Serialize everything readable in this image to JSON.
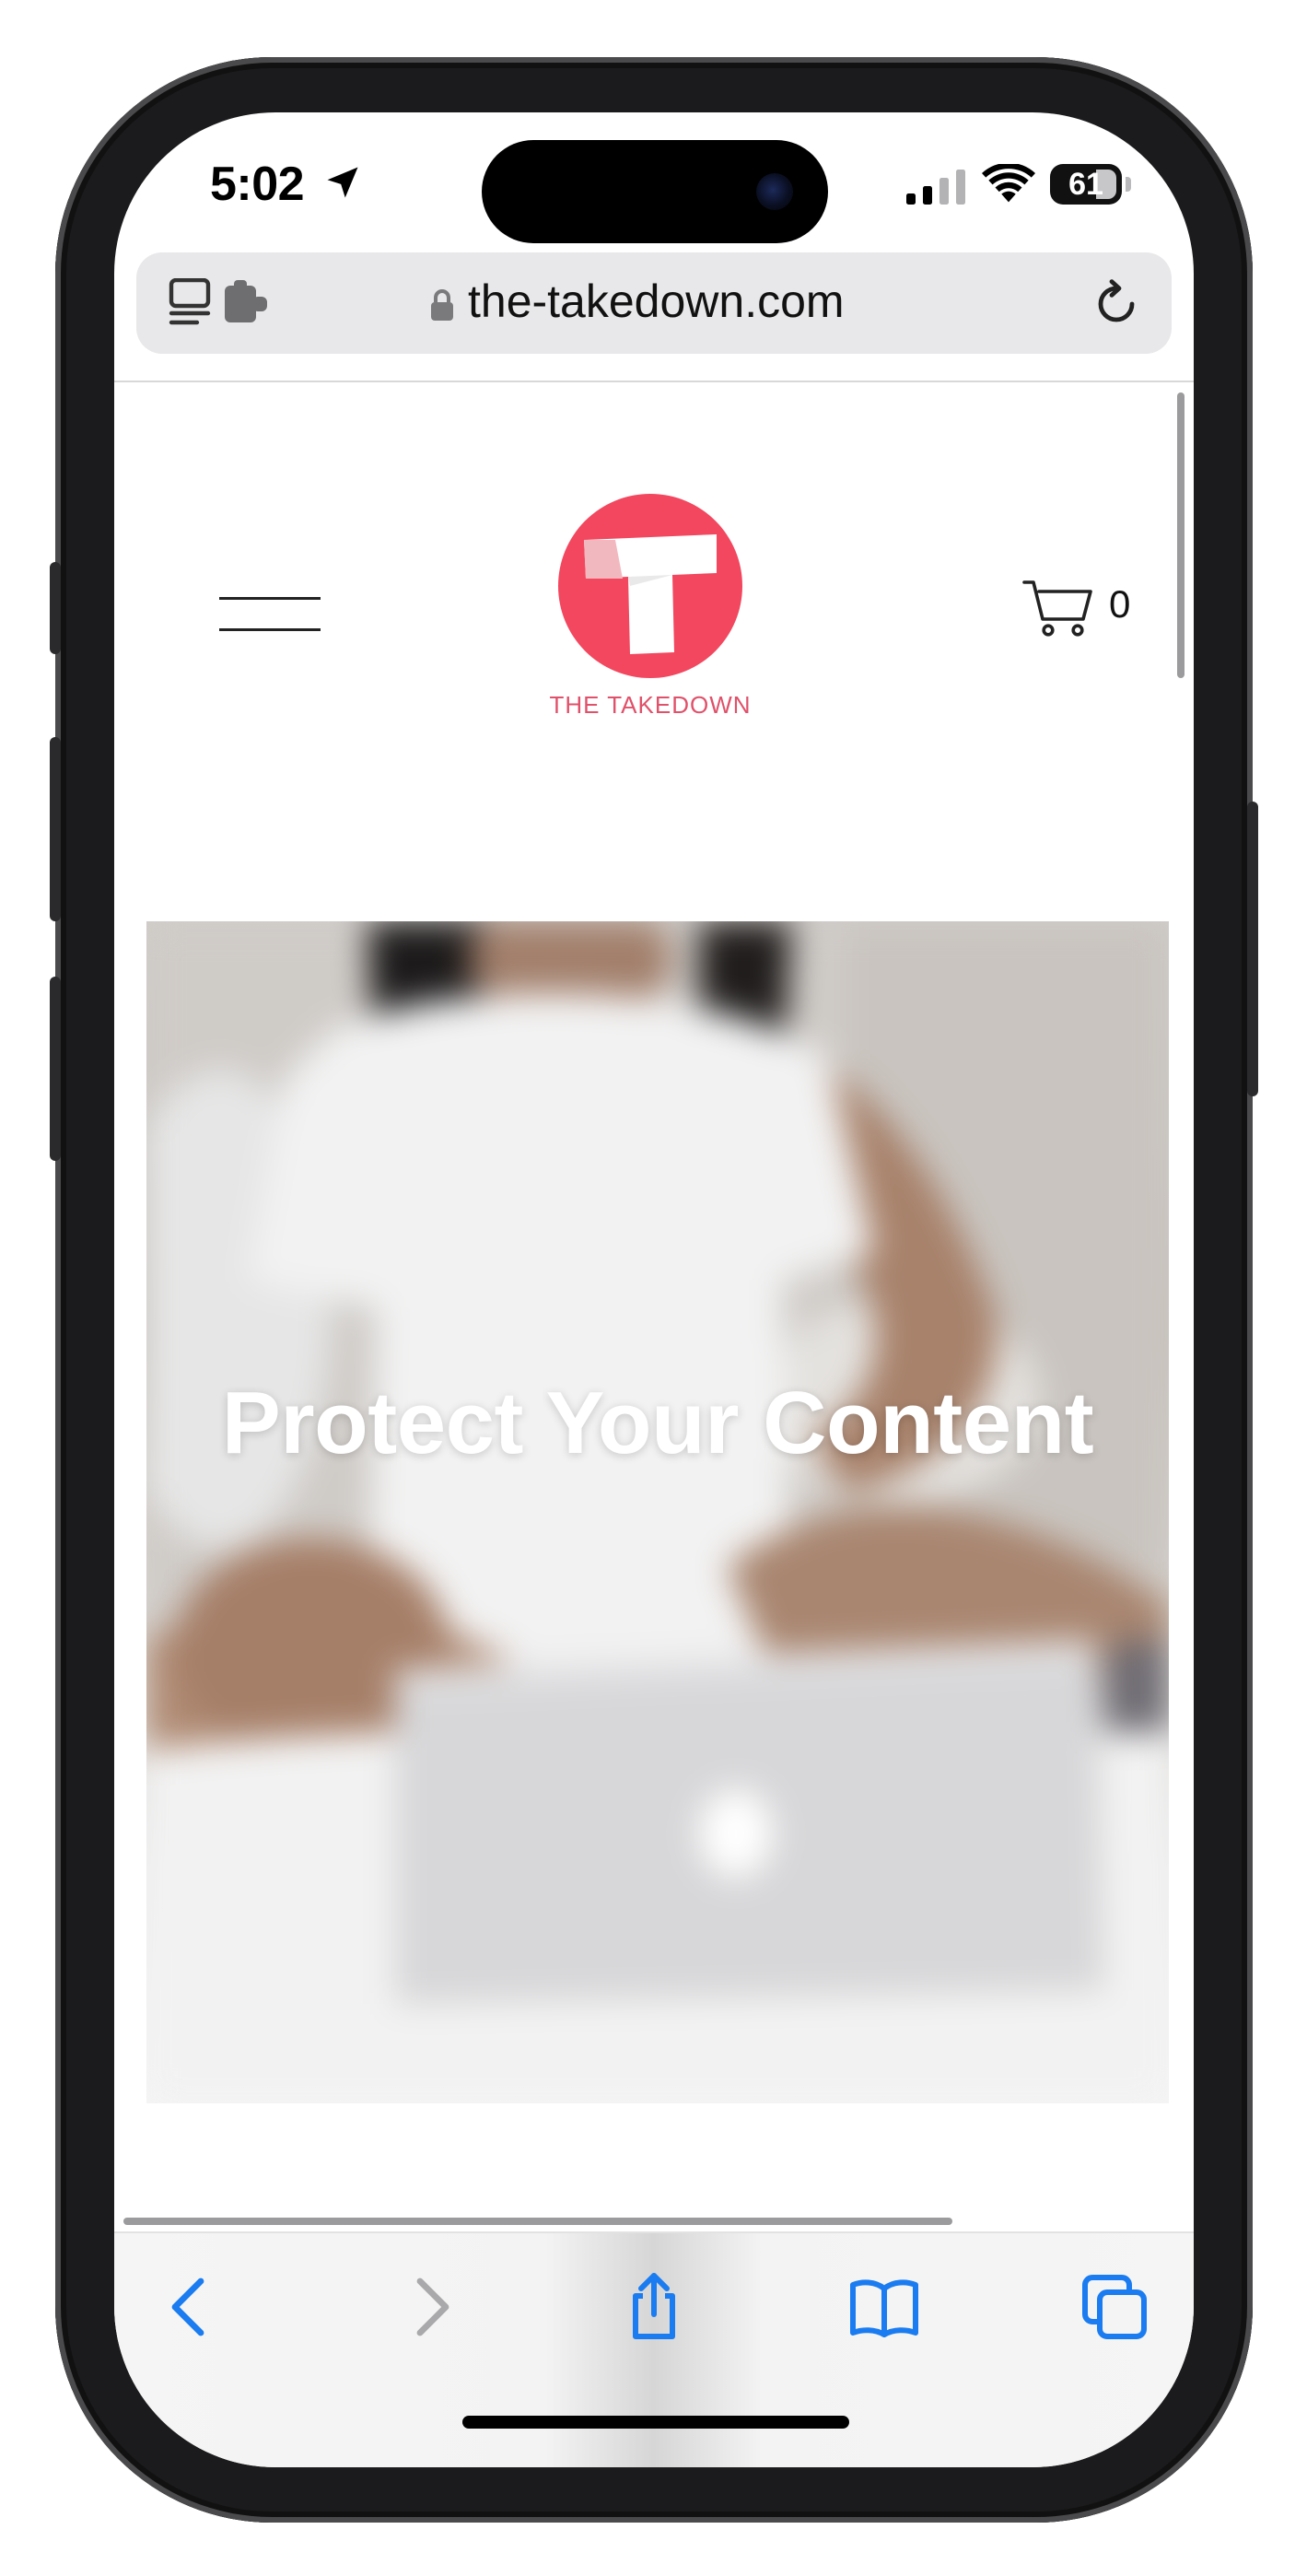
{
  "status_bar": {
    "time": "5:02",
    "battery": "61"
  },
  "browser": {
    "url": "the-takedown.com"
  },
  "site": {
    "brand": "THE TAKEDOWN",
    "logo_letter": "T",
    "cart_count": "0",
    "accent_color": "#f2475e"
  },
  "hero": {
    "title": "Protect Your Content"
  },
  "icons": {
    "status": [
      "location-arrow-icon",
      "cellular-signal-icon",
      "wifi-icon",
      "battery-icon"
    ],
    "urlbar": [
      "tab-layout-icon",
      "extension-icon",
      "lock-icon",
      "reload-icon"
    ],
    "toolbar": [
      "back-icon",
      "forward-icon",
      "share-icon",
      "bookmarks-icon",
      "tabs-icon"
    ],
    "header": [
      "menu-icon",
      "cart-icon"
    ]
  },
  "colors": {
    "toolbar_icon": "#1a7cf0",
    "toolbar_icon_disabled": "#a9a9ab"
  }
}
